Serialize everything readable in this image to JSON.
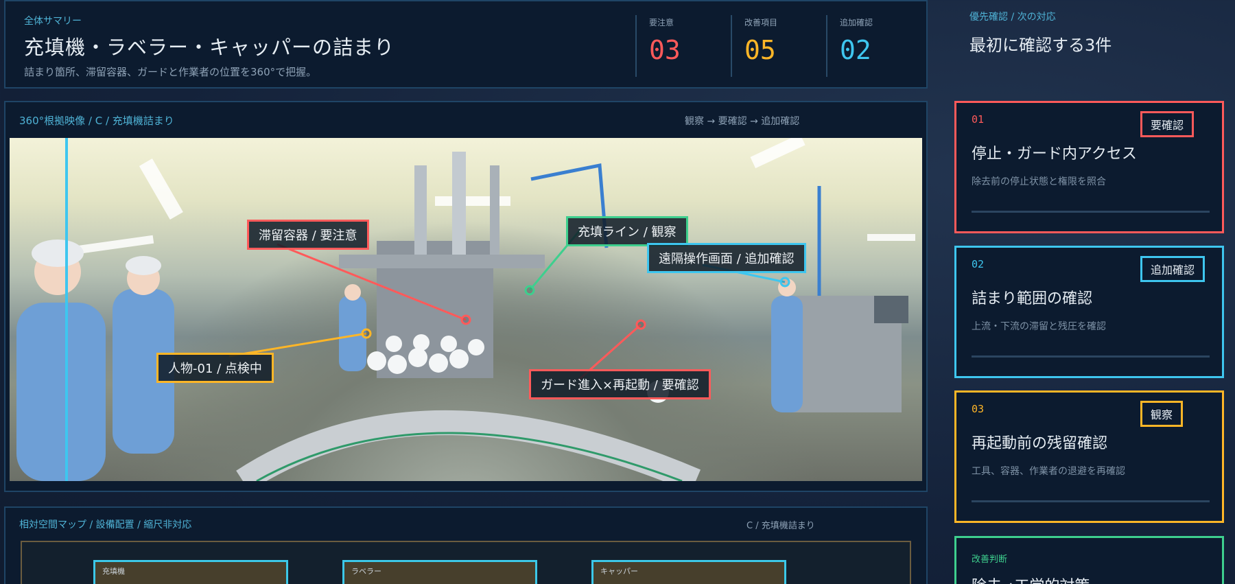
{
  "summary": {
    "eyebrow": "全体サマリー",
    "title": "充填機・ラベラー・キャッパーの詰まり",
    "description": "詰まり箇所、滞留容器、ガードと作業者の位置を360°で把握。",
    "stats": [
      {
        "label": "要注意",
        "value": "03",
        "color": "#ff5a5a"
      },
      {
        "label": "改善項目",
        "value": "05",
        "color": "#ffb627"
      },
      {
        "label": "追加確認",
        "value": "02",
        "color": "#3ec6ef"
      }
    ]
  },
  "video": {
    "heading": "360°根拠映像 / C / 充填機詰まり",
    "flow": "観察 → 要確認 → 追加確認",
    "tags": [
      {
        "label": "滞留容器 / 要注意",
        "color": "#ff5a5a"
      },
      {
        "label": "充填ライン / 観察",
        "color": "#3ecf8e"
      },
      {
        "label": "遠隔操作画面 / 追加確認",
        "color": "#3ec6ef"
      },
      {
        "label": "人物-01 / 点検中",
        "color": "#ffb627"
      },
      {
        "label": "ガード進入×再起動 / 要確認",
        "color": "#ff5a5a"
      }
    ]
  },
  "map": {
    "heading": "相対空間マップ / 設備配置 / 縮尺非対応",
    "context": "C / 充填機詰まり",
    "machines": [
      "充填機",
      "ラベラー",
      "キャッパー"
    ]
  },
  "priority": {
    "eyebrow": "優先確認 / 次の対応",
    "title": "最初に確認する3件",
    "cards": [
      {
        "num": "01",
        "badge": "要確認",
        "title": "停止・ガード内アクセス",
        "desc": "除去前の停止状態と権限を照合",
        "color": "#ff5a5a"
      },
      {
        "num": "02",
        "badge": "追加確認",
        "title": "詰まり範囲の確認",
        "desc": "上流・下流の滞留と残圧を確認",
        "color": "#3ec6ef"
      },
      {
        "num": "03",
        "badge": "観察",
        "title": "再起動前の残留確認",
        "desc": "工具、容器、作業者の退避を再確認",
        "color": "#ffb627"
      }
    ],
    "improvement": {
      "eyebrow": "改善判断",
      "title": "除去→工学的対策",
      "color": "#3ecf8e"
    }
  }
}
